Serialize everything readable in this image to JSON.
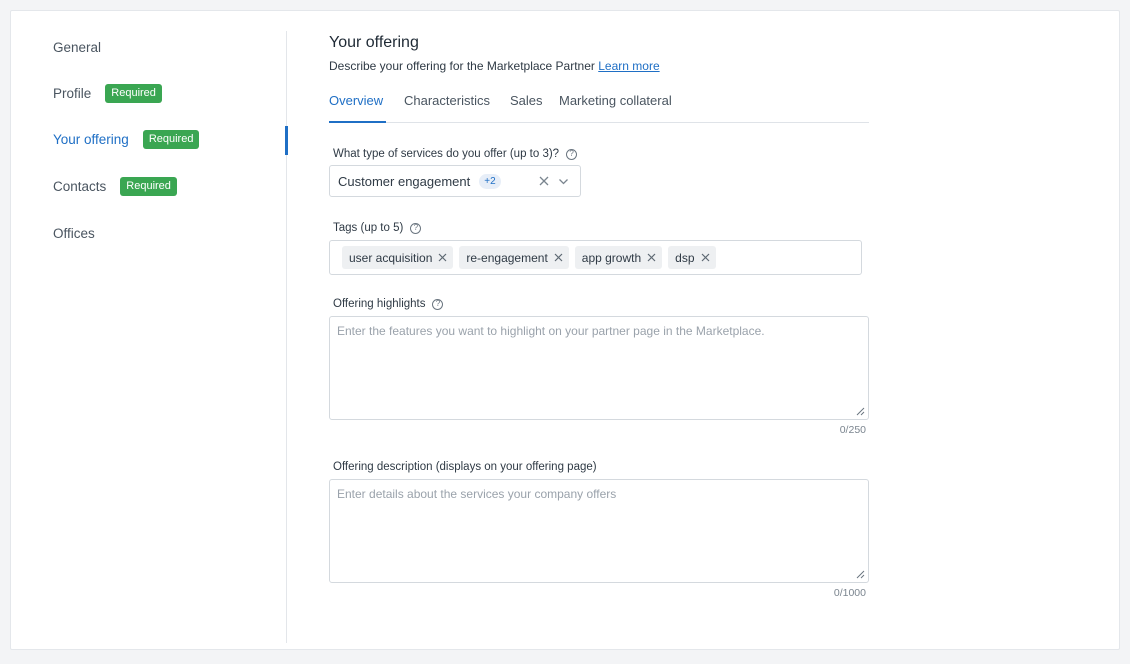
{
  "sidebar": {
    "items": [
      {
        "label": "General",
        "badge": ""
      },
      {
        "label": "Profile",
        "badge": "Required"
      },
      {
        "label": "Your offering",
        "badge": "Required"
      },
      {
        "label": "Contacts",
        "badge": "Required"
      },
      {
        "label": "Offices",
        "badge": ""
      }
    ],
    "active_index": 2
  },
  "header": {
    "title": "Your offering",
    "subtitle": "Describe your offering for the Marketplace Partner",
    "learn_more": "Learn more"
  },
  "tabs": [
    "Overview",
    "Characteristics",
    "Sales",
    "Marketing collateral"
  ],
  "services": {
    "label": "What type of services do you offer (up to 3)?",
    "value": "Customer engagement",
    "extra_count": "+2"
  },
  "tags": {
    "label": "Tags (up to 5)",
    "items": [
      "user acquisition",
      "re-engagement",
      "app growth",
      "dsp"
    ]
  },
  "highlights": {
    "label": "Offering highlights",
    "placeholder": "Enter the features you want to highlight on your partner page in the Marketplace.",
    "counter": "0/250"
  },
  "description": {
    "label": "Offering description (displays on your offering page)",
    "placeholder": "Enter details about the services your company offers",
    "counter": "0/1000"
  },
  "colors": {
    "accent": "#1f6fc5",
    "badge": "#3aa652"
  }
}
